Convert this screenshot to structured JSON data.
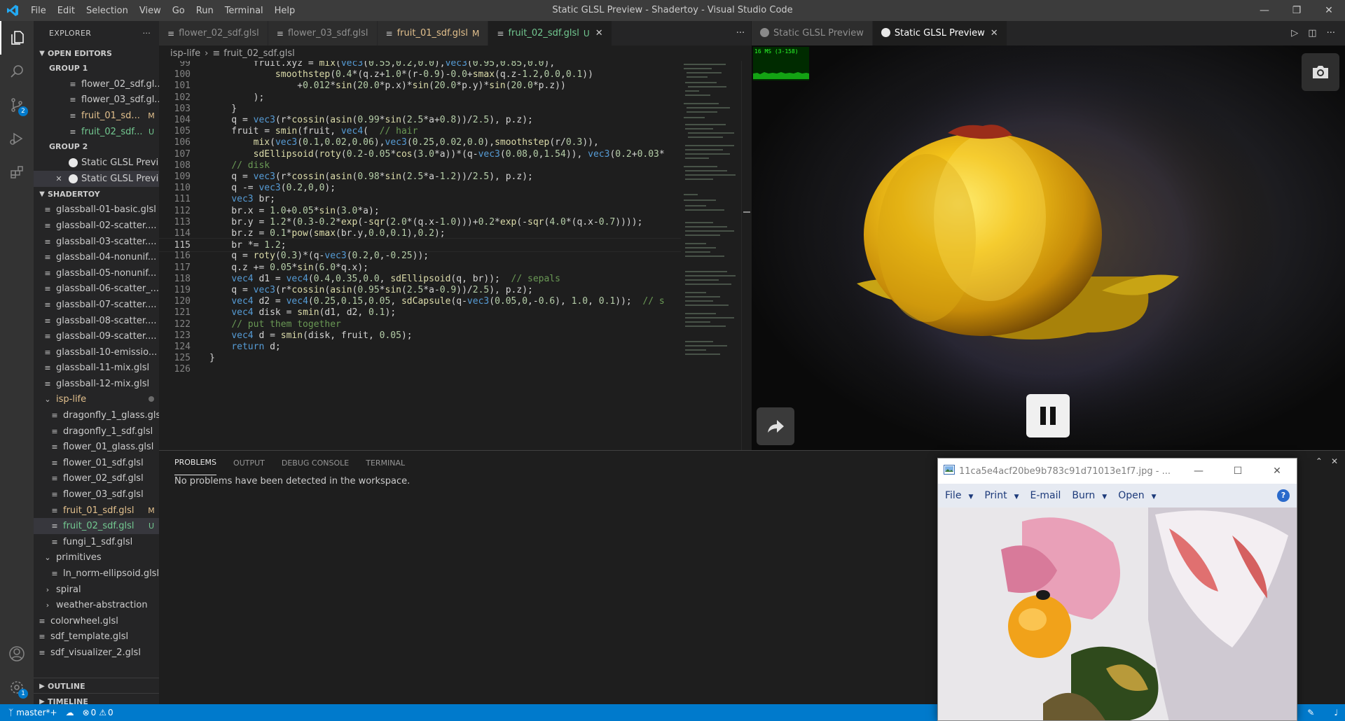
{
  "window": {
    "title": "Static GLSL Preview - Shadertoy - Visual Studio Code"
  },
  "menu": [
    "File",
    "Edit",
    "Selection",
    "View",
    "Go",
    "Run",
    "Terminal",
    "Help"
  ],
  "activity": {
    "scm_badge": "2",
    "settings_badge": "1"
  },
  "explorer": {
    "title": "EXPLORER",
    "open_editors": "OPEN EDITORS",
    "group1": "GROUP 1",
    "group1_items": [
      {
        "label": "flower_02_sdf.gl...",
        "status": ""
      },
      {
        "label": "flower_03_sdf.gl...",
        "status": ""
      },
      {
        "label": "fruit_01_sd...",
        "status": "M"
      },
      {
        "label": "fruit_02_sdf...",
        "status": "U"
      }
    ],
    "group2": "GROUP 2",
    "group2_items": [
      {
        "label": "Static GLSL Previ..."
      },
      {
        "label": "Static GLSL Previ..."
      }
    ],
    "folder": "SHADERTOY",
    "files": [
      "glassball-01-basic.glsl",
      "glassball-02-scatter....",
      "glassball-03-scatter....",
      "glassball-04-nonunif...",
      "glassball-05-nonunif...",
      "glassball-06-scatter_...",
      "glassball-07-scatter....",
      "glassball-08-scatter....",
      "glassball-09-scatter....",
      "glassball-10-emissio...",
      "glassball-11-mix.glsl",
      "glassball-12-mix.glsl"
    ],
    "subfolder": "isp-life",
    "sub_files": [
      {
        "label": "dragonfly_1_glass.glsl",
        "status": ""
      },
      {
        "label": "dragonfly_1_sdf.glsl",
        "status": ""
      },
      {
        "label": "flower_01_glass.glsl",
        "status": ""
      },
      {
        "label": "flower_01_sdf.glsl",
        "status": ""
      },
      {
        "label": "flower_02_sdf.glsl",
        "status": ""
      },
      {
        "label": "flower_03_sdf.glsl",
        "status": ""
      },
      {
        "label": "fruit_01_sdf.glsl",
        "status": "M"
      },
      {
        "label": "fruit_02_sdf.glsl",
        "status": "U"
      },
      {
        "label": "fungi_1_sdf.glsl",
        "status": ""
      }
    ],
    "folders_after": [
      "primitives",
      "ln_norm-ellipsoid.glsl",
      "spiral",
      "weather-abstraction"
    ],
    "root_files": [
      "colorwheel.glsl",
      "sdf_template.glsl",
      "sdf_visualizer_2.glsl"
    ],
    "outline": "OUTLINE",
    "timeline": "TIMELINE"
  },
  "tabs": [
    {
      "label": "flower_02_sdf.glsl",
      "badge": ""
    },
    {
      "label": "flower_03_sdf.glsl",
      "badge": ""
    },
    {
      "label": "fruit_01_sdf.glsl",
      "badge": "M"
    },
    {
      "label": "fruit_02_sdf.glsl",
      "badge": "U"
    }
  ],
  "breadcrumb": [
    "isp-life",
    "fruit_02_sdf.glsl"
  ],
  "code": [
    {
      "n": "99",
      "t": "        fruit.xyz = mix(vec3(0.55,0.2,0.0),vec3(0.95,0.85,0.0),"
    },
    {
      "n": "100",
      "t": "            smoothstep(0.4*(q.z+1.0*(r-0.9)-0.0+smax(q.z-1.2,0.0,0.1))"
    },
    {
      "n": "101",
      "t": "                +0.012*sin(20.0*p.x)*sin(20.0*p.y)*sin(20.0*p.z))"
    },
    {
      "n": "102",
      "t": "        );"
    },
    {
      "n": "103",
      "t": "    }"
    },
    {
      "n": "104",
      "t": "    q = vec3(r*cossin(asin(0.99*sin(2.5*a+0.8))/2.5), p.z);"
    },
    {
      "n": "105",
      "t": "    fruit = smin(fruit, vec4(  // hair"
    },
    {
      "n": "106",
      "t": "        mix(vec3(0.1,0.02,0.06),vec3(0.25,0.02,0.0),smoothstep(r/0.3)),"
    },
    {
      "n": "107",
      "t": "        sdEllipsoid(roty(0.2-0.05*cos(3.0*a))*(q-vec3(0.08,0,1.54)), vec3(0.2+0.03*"
    },
    {
      "n": "108",
      "t": "    // disk"
    },
    {
      "n": "109",
      "t": "    q = vec3(r*cossin(asin(0.98*sin(2.5*a-1.2))/2.5), p.z);"
    },
    {
      "n": "110",
      "t": "    q -= vec3(0.2,0,0);"
    },
    {
      "n": "111",
      "t": "    vec3 br;"
    },
    {
      "n": "112",
      "t": "    br.x = 1.0+0.05*sin(3.0*a);"
    },
    {
      "n": "113",
      "t": "    br.y = 1.2*(0.3-0.2*exp(-sqr(2.0*(q.x-1.0)))+0.2*exp(-sqr(4.0*(q.x-0.7))));"
    },
    {
      "n": "114",
      "t": "    br.z = 0.1*pow(smax(br.y,0.0,0.1),0.2);"
    },
    {
      "n": "115",
      "t": "    br *= 1.2;"
    },
    {
      "n": "116",
      "t": "    q = roty(0.3)*(q-vec3(0.2,0,-0.25));"
    },
    {
      "n": "117",
      "t": "    q.z += 0.05*sin(6.0*q.x);"
    },
    {
      "n": "118",
      "t": "    vec4 d1 = vec4(0.4,0.35,0.0, sdEllipsoid(q, br));  // sepals"
    },
    {
      "n": "119",
      "t": "    q = vec3(r*cossin(asin(0.95*sin(2.5*a-0.9))/2.5), p.z);"
    },
    {
      "n": "120",
      "t": "    vec4 d2 = vec4(0.25,0.15,0.05, sdCapsule(q-vec3(0.05,0,-0.6), 1.0, 0.1));  // s"
    },
    {
      "n": "121",
      "t": "    vec4 disk = smin(d1, d2, 0.1);"
    },
    {
      "n": "122",
      "t": "    // put them together"
    },
    {
      "n": "123",
      "t": "    vec4 d = smin(disk, fruit, 0.05);"
    },
    {
      "n": "124",
      "t": "    return d;"
    },
    {
      "n": "125",
      "t": "}"
    },
    {
      "n": "126",
      "t": ""
    }
  ],
  "preview": {
    "tabs": [
      "Static GLSL Preview",
      "Static GLSL Preview"
    ],
    "fps": "16 MS (3-158)"
  },
  "panel": {
    "tabs": [
      "PROBLEMS",
      "OUTPUT",
      "DEBUG CONSOLE",
      "TERMINAL"
    ],
    "message": "No problems have been detected in the workspace."
  },
  "status": {
    "branch": "master*+",
    "errors": "0",
    "warnings": "0"
  },
  "viewer": {
    "title": "11ca5e4acf20be9b783c91d71013e1f7.jpg - ...",
    "menu": [
      "File",
      "Print",
      "E-mail",
      "Burn",
      "Open"
    ],
    "menu_carets": [
      true,
      true,
      false,
      true,
      true
    ],
    "help": "?"
  }
}
